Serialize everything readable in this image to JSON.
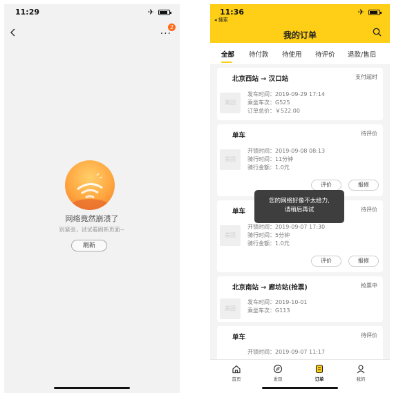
{
  "left": {
    "status_time": "11:29",
    "badge": "2",
    "error_title": "网络竟然崩溃了",
    "error_subtitle": "别紧张，试试看刷新页面~",
    "refresh_label": "刷新"
  },
  "right": {
    "status_time": "11:36",
    "back_app": "◂ 搜索",
    "title": "我的订单",
    "tabs": [
      {
        "label": "全部",
        "active": true
      },
      {
        "label": "待付款"
      },
      {
        "label": "待使用"
      },
      {
        "label": "待评价"
      },
      {
        "label": "退款/售后"
      }
    ],
    "orders": [
      {
        "title": "北京西站 → 汉口站",
        "status": "支付超时",
        "thumb": "美团",
        "lines": [
          "发车时间：2019-09-29 17:14",
          "乘坐车次：G525",
          "订单总价：￥522.00"
        ]
      },
      {
        "title": "单车",
        "status": "待评价",
        "thumb": "美团",
        "lines": [
          "开锁时间：2019-09-08 08:13",
          "骑行时间：11分钟",
          "骑行金额：1.0元"
        ],
        "buttons": [
          "评价",
          "报修"
        ]
      },
      {
        "title": "单车",
        "status": "待评价",
        "thumb": "美团",
        "lines": [
          "开锁时间：2019-09-07 17:30",
          "骑行时间：5分钟",
          "骑行金额：1.0元"
        ],
        "buttons": [
          "评价",
          "报修"
        ]
      },
      {
        "title": "北京南站 → 廊坊站(抢票)",
        "status": "抢票中",
        "thumb": "美团",
        "lines": [
          "发车时间：2019-10-01",
          "乘坐车次：G113"
        ]
      },
      {
        "title": "单车",
        "status": "待评价",
        "lines": [
          "开锁时间：2019-09-07 11:17"
        ]
      }
    ],
    "toast": [
      "您的网络好像不太给力,",
      "请稍后再试"
    ],
    "tabbar": [
      {
        "label": "首页",
        "icon": "home-icon"
      },
      {
        "label": "发现",
        "icon": "compass-icon"
      },
      {
        "label": "订单",
        "icon": "order-icon",
        "active": true
      },
      {
        "label": "我的",
        "icon": "profile-icon"
      }
    ]
  },
  "colors": {
    "brand_yellow": "#ffcf17",
    "badge_orange": "#ff6a1a",
    "toast_bg": "#1e1e1e"
  }
}
